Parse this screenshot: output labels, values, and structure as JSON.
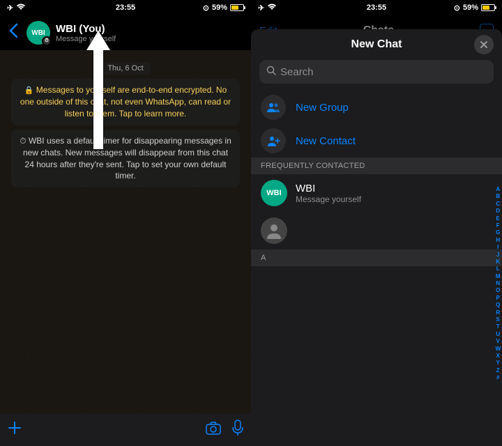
{
  "status": {
    "time": "23:55",
    "battery": "59%"
  },
  "left": {
    "header": {
      "title": "WBI (You)",
      "subtitle": "Message yourself",
      "avatar_text": "WBI"
    },
    "date": "Thu, 6 Oct",
    "encryption_msg": "Messages to yourself are end-to-end encrypted. No one outside of this chat, not even WhatsApp, can read or listen to them. Tap to learn more.",
    "timer_msg": "WBI uses a default timer for disappearing messages in new chats. New messages will disappear from this chat 24 hours after they're sent. Tap to set your own default timer."
  },
  "right": {
    "bg_edit": "Edit",
    "bg_title": "Chats",
    "sheet_title": "New Chat",
    "search_placeholder": "Search",
    "new_group": "New Group",
    "new_contact": "New Contact",
    "freq_header": "FREQUENTLY CONTACTED",
    "contact_wbi": {
      "name": "WBI",
      "sub": "Message yourself",
      "avatar": "WBI"
    },
    "letter_header": "A",
    "az": [
      "A",
      "B",
      "C",
      "D",
      "E",
      "F",
      "G",
      "H",
      "I",
      "J",
      "K",
      "L",
      "M",
      "N",
      "O",
      "P",
      "Q",
      "R",
      "S",
      "T",
      "U",
      "V",
      "W",
      "X",
      "Y",
      "Z",
      "#"
    ]
  }
}
